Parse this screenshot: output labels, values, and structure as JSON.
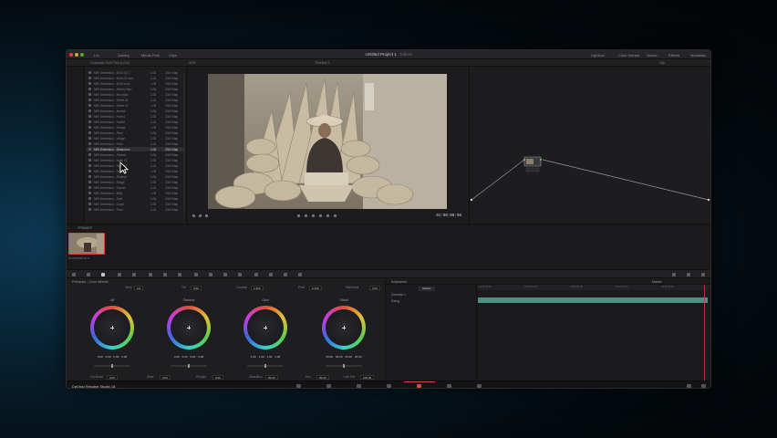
{
  "app": {
    "title": "Untitled Project 1",
    "title_status": "Edited",
    "brand": "DaVinci Resolve Studio 18"
  },
  "titlebar": {
    "left_items": [
      "Lut",
      "Gallery",
      "Media Pool",
      "Clips"
    ],
    "right_items": [
      "Lightbox",
      "Color Warper",
      "Nodes",
      "Effects",
      "Metadata"
    ]
  },
  "subbar": {
    "bin_label": "Channels 2023 Pink (LOG)",
    "zoom": "40%",
    "clip_name": "Timeline 2",
    "right_label": "Clip"
  },
  "media_pool": {
    "rows": [
      {
        "name": "MRI Dimension - 6000 (1) C",
        "c2": "1:05",
        "c3": "2024 Map"
      },
      {
        "name": "MRI Dimension - 6000-01.mov",
        "c2": "1:05",
        "c3": "2024 Map"
      },
      {
        "name": "MRI Dimension - 60/61.mov",
        "c2": "1:05",
        "c3": "2024 Map"
      },
      {
        "name": "MRI Dimension - Beach Clips",
        "c2": "1:05",
        "c3": "2024 Map"
      },
      {
        "name": "MRI Dimension - Mountain",
        "c2": "1:05",
        "c3": "2024 Map"
      },
      {
        "name": "MRI Dimension - Street 01",
        "c2": "1:05",
        "c3": "2024 Map"
      },
      {
        "name": "MRI Dimension - Street 02",
        "c2": "1:05",
        "c3": "2024 Map"
      },
      {
        "name": "MRI Dimension - Market",
        "c2": "1:05",
        "c3": "2024 Map"
      },
      {
        "name": "MRI Dimension - Forest",
        "c2": "1:05",
        "c3": "2024 Map"
      },
      {
        "name": "MRI Dimension - Harbor",
        "c2": "1:05",
        "c3": "2024 Map"
      },
      {
        "name": "MRI Dimension - Temple",
        "c2": "1:05",
        "c3": "2024 Map"
      },
      {
        "name": "MRI Dimension - River",
        "c2": "1:05",
        "c3": "2024 Map"
      },
      {
        "name": "MRI Dimension - Village",
        "c2": "1:05",
        "c3": "2024 Map"
      },
      {
        "name": "MRI Dimension - Field",
        "c2": "1:05",
        "c3": "2024 Map"
      },
      {
        "name": "MRI Dimension - Straw.mov",
        "c2": "1:05",
        "c3": "2024 Map"
      },
      {
        "name": "MRI Dimension - Portrait",
        "c2": "1:05",
        "c3": "2024 Map"
      },
      {
        "name": "MRI Dimension - Night 01",
        "c2": "1:05",
        "c3": "2024 Map"
      },
      {
        "name": "MRI Dimension - Night 02",
        "c2": "1:05",
        "c3": "2024 Map"
      },
      {
        "name": "MRI Dimension - Dock",
        "c2": "1:05",
        "c3": "2024 Map"
      },
      {
        "name": "MRI Dimension - Rooftop",
        "c2": "1:05",
        "c3": "2024 Map"
      },
      {
        "name": "MRI Dimension - Bridge",
        "c2": "1:05",
        "c3": "2024 Map"
      },
      {
        "name": "MRI Dimension - Sunset",
        "c2": "1:05",
        "c3": "2024 Map"
      },
      {
        "name": "MRI Dimension - Alley",
        "c2": "1:05",
        "c3": "2024 Map"
      },
      {
        "name": "MRI Dimension - Rain",
        "c2": "1:05",
        "c3": "2024 Map"
      },
      {
        "name": "MRI Dimension - Coast",
        "c2": "1:05",
        "c3": "2024 Map"
      },
      {
        "name": "MRI Dimension - Final",
        "c2": "1:05",
        "c3": "2024 Map"
      }
    ],
    "selected_index": 14
  },
  "viewer": {
    "timecode": "01:00:00:08"
  },
  "gallery": {
    "label": "PRIMARY",
    "thumb_caption": "01 00:00:00 V1 C"
  },
  "color_panel": {
    "title": "Primaries - Color Wheels",
    "params": [
      {
        "label": "Temp",
        "value": "0.0"
      },
      {
        "label": "Tint",
        "value": "0.00"
      },
      {
        "label": "Contrast",
        "value": "1.000"
      },
      {
        "label": "Pivot",
        "value": "0.435"
      },
      {
        "label": "Mid/Detail",
        "value": "0.00"
      }
    ],
    "wheels": [
      {
        "name": "Lift",
        "values": [
          "0.00",
          "0.00",
          "0.00",
          "0.00"
        ]
      },
      {
        "name": "Gamma",
        "values": [
          "0.00",
          "0.00",
          "0.00",
          "0.00"
        ]
      },
      {
        "name": "Gain",
        "values": [
          "1.00",
          "1.00",
          "1.00",
          "1.00"
        ]
      },
      {
        "name": "Offset",
        "values": [
          "25.00",
          "25.00",
          "25.00",
          "25.00"
        ]
      }
    ],
    "footer": [
      {
        "label": "Col Boost",
        "value": "0.00"
      },
      {
        "label": "Shad",
        "value": "0.00"
      },
      {
        "label": "Hi/Light",
        "value": "0.00"
      },
      {
        "label": "Saturation",
        "value": "50.00"
      },
      {
        "label": "Hue",
        "value": "50.00"
      },
      {
        "label": "Lum Mix",
        "value": "100.00"
      }
    ]
  },
  "keyframes": {
    "title": "Keyframes",
    "filter": "Master",
    "rows": [
      "Corrector 1",
      "Sizing"
    ],
    "ruler": [
      "01:00:00:00",
      "01:00:00:04",
      "01:00:00:08",
      "01:00:00:12",
      "01:00:00:16",
      "01:00:00:20"
    ]
  },
  "colors": {
    "accent": "#d0503a",
    "track": "#4e8f86",
    "panel": "#1c1c1e"
  }
}
